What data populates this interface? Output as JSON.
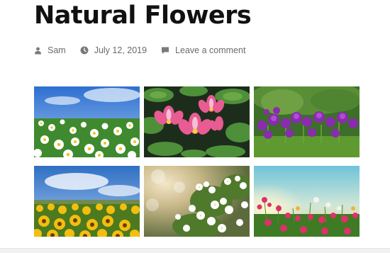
{
  "post": {
    "title": "Natural Flowers",
    "author": "Sam",
    "date": "July 12, 2019",
    "comment_link": "Leave a comment"
  },
  "icons": {
    "author": "person-icon",
    "date": "clock-icon",
    "comments": "comment-icon"
  },
  "gallery": [
    {
      "name": "daisies-photo"
    },
    {
      "name": "water-lilies-photo"
    },
    {
      "name": "purple-alliums-photo"
    },
    {
      "name": "sunflowers-photo"
    },
    {
      "name": "white-blossoms-photo"
    },
    {
      "name": "wildflowers-sunset-photo"
    }
  ],
  "colors": {
    "title": "#111111",
    "meta": "#6b6b6b"
  }
}
